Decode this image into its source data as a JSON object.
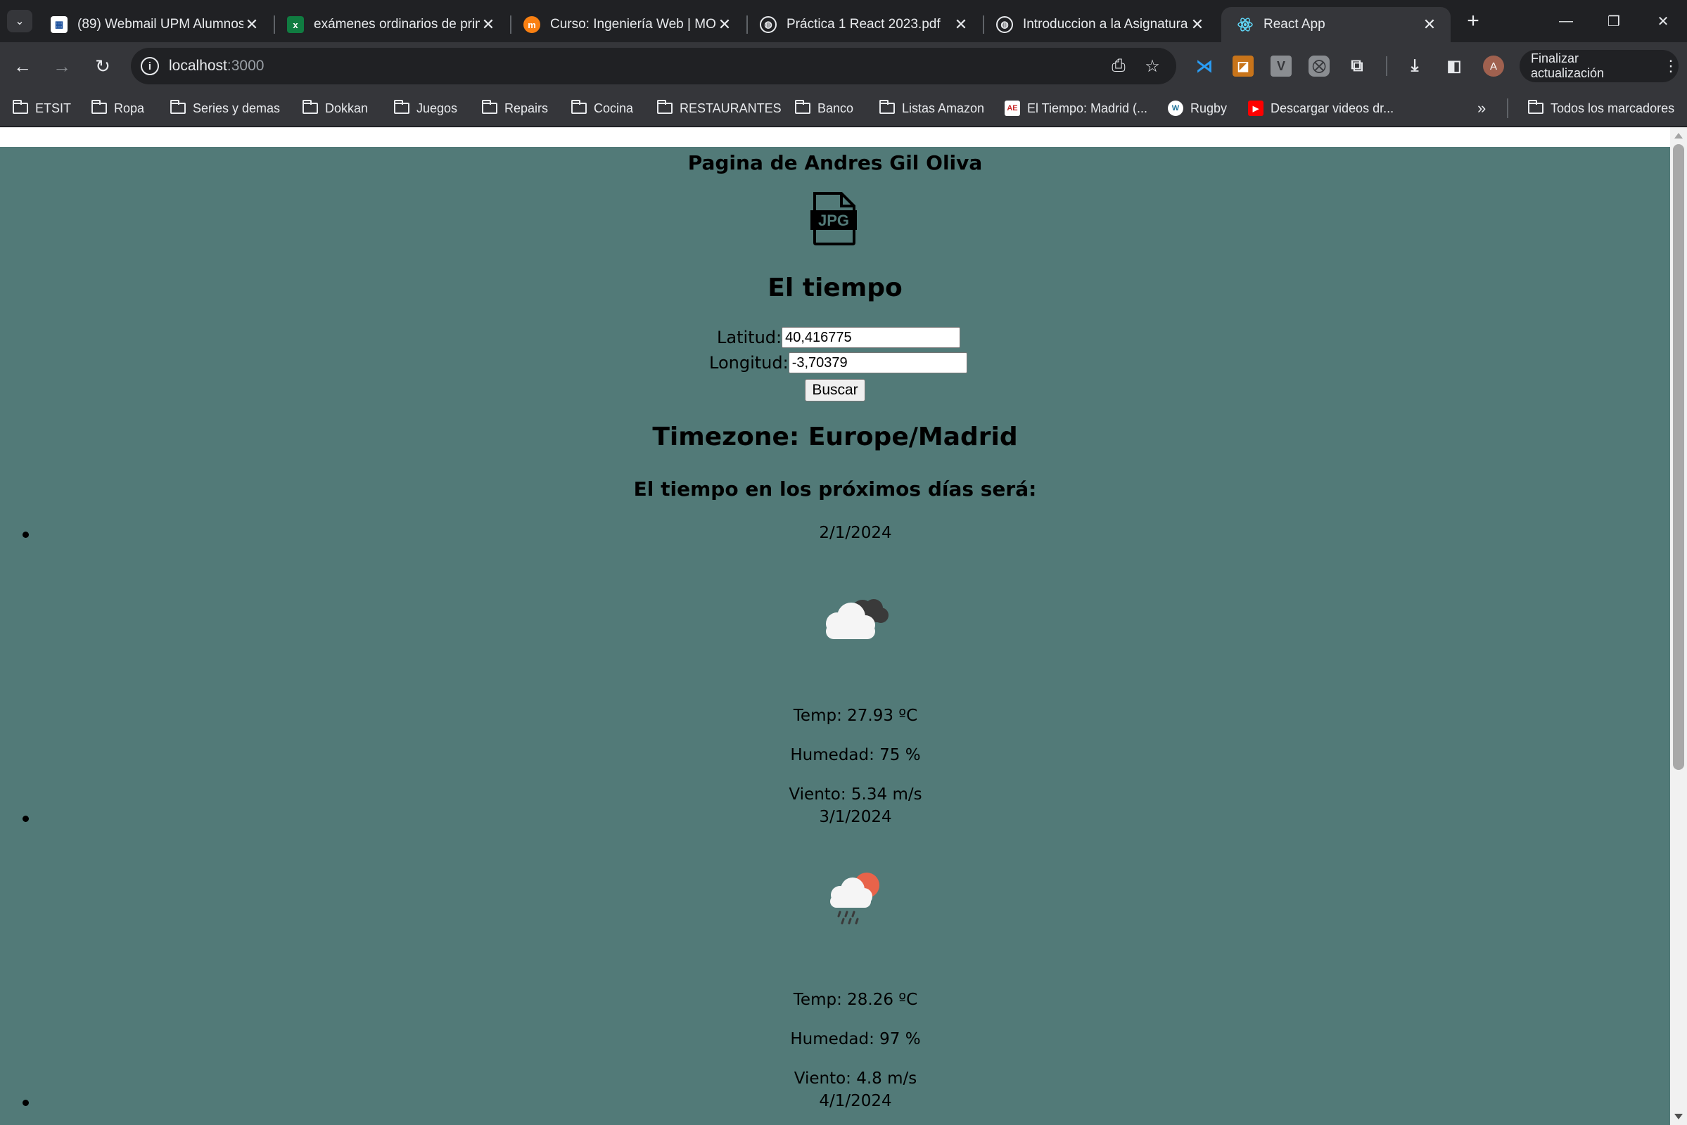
{
  "browser": {
    "tabs": [
      {
        "title": "(89) Webmail UPM Alumnos",
        "favicon": "upm-favicon"
      },
      {
        "title": "exámenes ordinarios de prim",
        "favicon": "excel-favicon"
      },
      {
        "title": "Curso: Ingeniería Web | MOO",
        "favicon": "moodle-favicon"
      },
      {
        "title": "Práctica 1 React 2023.pdf",
        "favicon": "globe-favicon"
      },
      {
        "title": "Introduccion a la Asignatura",
        "favicon": "globe-favicon"
      },
      {
        "title": "React App",
        "favicon": "react-favicon"
      }
    ],
    "active_tab": 5,
    "url_host": "localhost",
    "url_port": ":3000",
    "update_button": "Finalizar actualización",
    "profile_initial": "A",
    "bookmarks": [
      {
        "label": "ETSIT",
        "icon": "folder-icon"
      },
      {
        "label": "Ropa",
        "icon": "folder-icon"
      },
      {
        "label": "Series y demas",
        "icon": "folder-icon"
      },
      {
        "label": "Dokkan",
        "icon": "folder-icon"
      },
      {
        "label": "Juegos",
        "icon": "folder-icon"
      },
      {
        "label": "Repairs",
        "icon": "folder-icon"
      },
      {
        "label": "Cocina",
        "icon": "folder-icon"
      },
      {
        "label": "RESTAURANTES",
        "icon": "folder-icon"
      },
      {
        "label": "Banco",
        "icon": "folder-icon"
      },
      {
        "label": "Listas Amazon",
        "icon": "folder-icon"
      },
      {
        "label": "El Tiempo: Madrid (...",
        "icon": "eltiempo-favicon"
      },
      {
        "label": "Rugby",
        "icon": "wordpress-icon"
      },
      {
        "label": "Descargar videos dr...",
        "icon": "youtube-icon"
      }
    ],
    "all_bookmarks": "Todos los marcadores"
  },
  "page": {
    "title": "Pagina de Andres Gil Oliva",
    "logo_icon": "jpg-file-icon",
    "heading": "El tiempo",
    "lat_label": "Latitud:",
    "lat_value": "40,416775",
    "lon_label": "Longitud:",
    "lon_value": "-3,70379",
    "search_button": "Buscar",
    "timezone": "Timezone: Europe/Madrid",
    "forecast_heading": "El tiempo en los próximos días será:",
    "days": [
      {
        "date": "2/1/2024",
        "icon": "cloudy-night-icon",
        "temp": "Temp: 27.93 ºC",
        "humidity": "Humedad: 75 %",
        "wind": "Viento: 5.34 m/s"
      },
      {
        "date": "3/1/2024",
        "icon": "rain-sun-icon",
        "temp": "Temp: 28.26 ºC",
        "humidity": "Humedad: 97 %",
        "wind": "Viento: 4.8 m/s"
      },
      {
        "date": "4/1/2024"
      }
    ]
  },
  "colors": {
    "page_background": "#527a78",
    "browser_dark": "#202124",
    "browser_toolbar": "#35363a"
  }
}
